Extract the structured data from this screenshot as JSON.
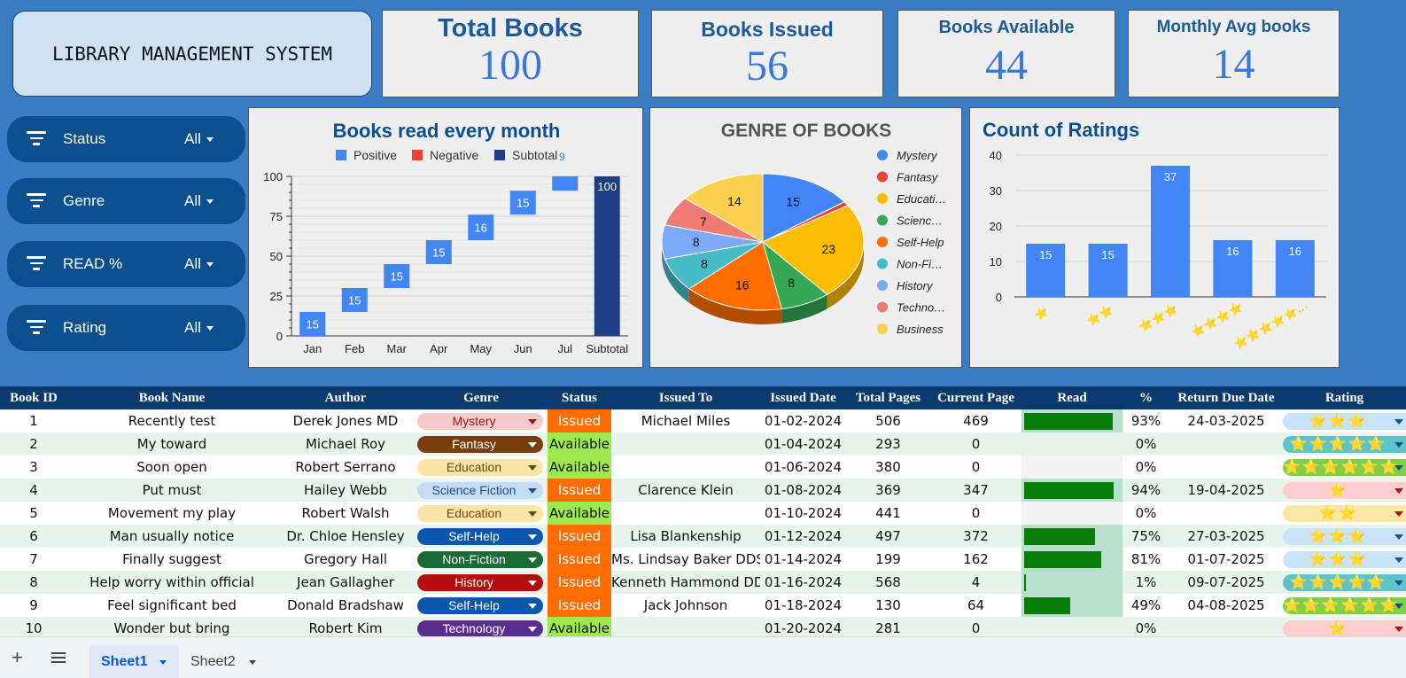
{
  "dashboard": {
    "title": "LIBRARY MANAGEMENT SYSTEM",
    "kpis": [
      {
        "label": "Total Books",
        "value": "100"
      },
      {
        "label": "Books Issued",
        "value": "56"
      },
      {
        "label": "Books Available",
        "value": "44"
      },
      {
        "label": "Monthly Avg books",
        "value": "14"
      }
    ],
    "slicers": [
      {
        "label": "Status",
        "value": "All"
      },
      {
        "label": "Genre",
        "value": "All"
      },
      {
        "label": "READ %",
        "value": "All"
      },
      {
        "label": "Rating",
        "value": "All"
      }
    ]
  },
  "chart_data": [
    {
      "type": "bar",
      "subtype": "waterfall",
      "title": "Books read every month",
      "legend": [
        "Positive",
        "Negative",
        "Subtotal"
      ],
      "legend_overflow_label": "9",
      "legend_position": "top",
      "categories": [
        "Jan",
        "Feb",
        "Mar",
        "Apr",
        "May",
        "Jun",
        "Jul",
        "Subtotal"
      ],
      "values": [
        15,
        15,
        15,
        15,
        16,
        15,
        9,
        100
      ],
      "data_labels": [
        "15",
        "15",
        "15",
        "15",
        "16",
        "15",
        "",
        "100"
      ],
      "y_ticks": [
        0,
        25,
        50,
        75,
        100
      ],
      "ylim": [
        0,
        100
      ],
      "colors": {
        "positive": "#4285f4",
        "negative": "#ea4335",
        "subtotal": "#1e3f87"
      },
      "grid": true
    },
    {
      "type": "pie",
      "title": "GENRE OF BOOKS",
      "three_d": true,
      "legend_position": "right",
      "labels": [
        "Mystery",
        "Fantasy",
        "Educati…",
        "Scienc…",
        "Self-Help",
        "Non-Fi…",
        "History",
        "Techno…",
        "Business"
      ],
      "values": [
        15,
        1,
        23,
        8,
        16,
        8,
        8,
        7,
        14
      ],
      "data_labels": [
        "15",
        "",
        "23",
        "8",
        "16",
        "8",
        "8",
        "7",
        "14"
      ],
      "colors": [
        "#4285f4",
        "#ea4335",
        "#fbbc04",
        "#34a853",
        "#ff6d01",
        "#46bdc6",
        "#7baaf7",
        "#f07b72",
        "#fcd04f"
      ]
    },
    {
      "type": "bar",
      "title": "Count of Ratings",
      "categories": [
        "⭐",
        "⭐⭐",
        "⭐⭐⭐",
        "⭐⭐⭐⭐",
        "⭐⭐⭐⭐⭐"
      ],
      "category_last_suffix": "…",
      "values": [
        15,
        15,
        37,
        16,
        16
      ],
      "y_ticks": [
        0,
        10,
        20,
        30,
        40
      ],
      "ylim": [
        0,
        40
      ],
      "color": "#4285f4",
      "grid": true
    }
  ],
  "table": {
    "headers": [
      "Book ID",
      "Book Name",
      "Author",
      "Genre",
      "Status",
      "Issued To",
      "Issued Date",
      "Total Pages",
      "Current Page",
      "Read",
      "%",
      "Return Due Date",
      "Rating"
    ],
    "rows": [
      {
        "id": "1",
        "name": "Recently test",
        "author": "Derek Jones MD",
        "genre": "Mystery",
        "status": "Issued",
        "issued_to": "Michael Miles",
        "date": "01-02-2024",
        "pages": "506",
        "current": "469",
        "read": 0.93,
        "pct": "93%",
        "due": "24-03-2025",
        "stars": "⭐⭐⭐"
      },
      {
        "id": "2",
        "name": "My toward",
        "author": "Michael Roy",
        "genre": "Fantasy",
        "status": "Available",
        "issued_to": "",
        "date": "01-04-2024",
        "pages": "293",
        "current": "0",
        "read": 0,
        "pct": "0%",
        "due": "",
        "stars": "⭐⭐⭐⭐⭐"
      },
      {
        "id": "3",
        "name": "Soon open",
        "author": "Robert Serrano",
        "genre": "Education",
        "status": "Available",
        "issued_to": "",
        "date": "01-06-2024",
        "pages": "380",
        "current": "0",
        "read": 0,
        "pct": "0%",
        "due": "",
        "stars": "⭐⭐⭐⭐⭐⭐"
      },
      {
        "id": "4",
        "name": "Put must",
        "author": "Hailey Webb",
        "genre": "Science Fiction",
        "status": "Issued",
        "issued_to": "Clarence Klein",
        "date": "01-08-2024",
        "pages": "369",
        "current": "347",
        "read": 0.94,
        "pct": "94%",
        "due": "19-04-2025",
        "stars": "⭐"
      },
      {
        "id": "5",
        "name": "Movement my play",
        "author": "Robert Walsh",
        "genre": "Education",
        "status": "Available",
        "issued_to": "",
        "date": "01-10-2024",
        "pages": "441",
        "current": "0",
        "read": 0,
        "pct": "0%",
        "due": "",
        "stars": "⭐⭐"
      },
      {
        "id": "6",
        "name": "Man usually notice",
        "author": "Dr. Chloe Hensley",
        "genre": "Self-Help",
        "status": "Issued",
        "issued_to": "Lisa Blankenship",
        "date": "01-12-2024",
        "pages": "497",
        "current": "372",
        "read": 0.75,
        "pct": "75%",
        "due": "27-03-2025",
        "stars": "⭐⭐⭐"
      },
      {
        "id": "7",
        "name": "Finally suggest",
        "author": "Gregory Hall",
        "genre": "Non-Fiction",
        "status": "Issued",
        "issued_to": "Ms. Lindsay Baker DDS",
        "date": "01-14-2024",
        "pages": "199",
        "current": "162",
        "read": 0.81,
        "pct": "81%",
        "due": "01-07-2025",
        "stars": "⭐⭐⭐"
      },
      {
        "id": "8",
        "name": "Help worry within official",
        "author": "Jean Gallagher",
        "genre": "History",
        "status": "Issued",
        "issued_to": "Kenneth Hammond DDS",
        "date": "01-16-2024",
        "pages": "568",
        "current": "4",
        "read": 0.01,
        "pct": "1%",
        "due": "09-07-2025",
        "stars": "⭐⭐⭐⭐⭐"
      },
      {
        "id": "9",
        "name": "Feel significant bed",
        "author": "Donald Bradshaw",
        "genre": "Self-Help",
        "status": "Issued",
        "issued_to": "Jack Johnson",
        "date": "01-18-2024",
        "pages": "130",
        "current": "64",
        "read": 0.49,
        "pct": "49%",
        "due": "04-08-2025",
        "stars": "⭐⭐⭐⭐⭐⭐"
      },
      {
        "id": "10",
        "name": "Wonder but bring",
        "author": "Robert Kim",
        "genre": "Technology",
        "status": "Available",
        "issued_to": "",
        "date": "01-20-2024",
        "pages": "281",
        "current": "0",
        "read": 0,
        "pct": "0%",
        "due": "",
        "stars": "⭐"
      }
    ]
  },
  "genre_colors": {
    "Mystery": {
      "bg": "#f8c9c9",
      "fg": "#8a1c1c"
    },
    "Fantasy": {
      "bg": "#7a3e0c",
      "fg": "#ffffff"
    },
    "Education": {
      "bg": "#fde4a8",
      "fg": "#6b4a00"
    },
    "Science Fiction": {
      "bg": "#c6dcf5",
      "fg": "#1a4f8a"
    },
    "Self-Help": {
      "bg": "#0b57b0",
      "fg": "#ffffff"
    },
    "Non-Fiction": {
      "bg": "#1a6b34",
      "fg": "#ffffff"
    },
    "History": {
      "bg": "#b40f0f",
      "fg": "#ffffff"
    },
    "Technology": {
      "bg": "#5b2d91",
      "fg": "#ffffff"
    }
  },
  "status_colors": {
    "Issued": "#ff6d01",
    "Available": "#9ee94e"
  },
  "rating_chip_colors": {
    "⭐⭐⭐": "#c9e4f8",
    "⭐⭐⭐⭐⭐": "#5ec4c9",
    "⭐⭐⭐⭐⭐⭐": "#7cd04c",
    "⭐": "#fccfcf",
    "⭐⭐": "#fde7a6"
  },
  "sheet_tabs": {
    "add_icon": "plus-icon",
    "menu_icon": "menu-icon",
    "tabs": [
      "Sheet1",
      "Sheet2"
    ],
    "active": "Sheet1"
  }
}
